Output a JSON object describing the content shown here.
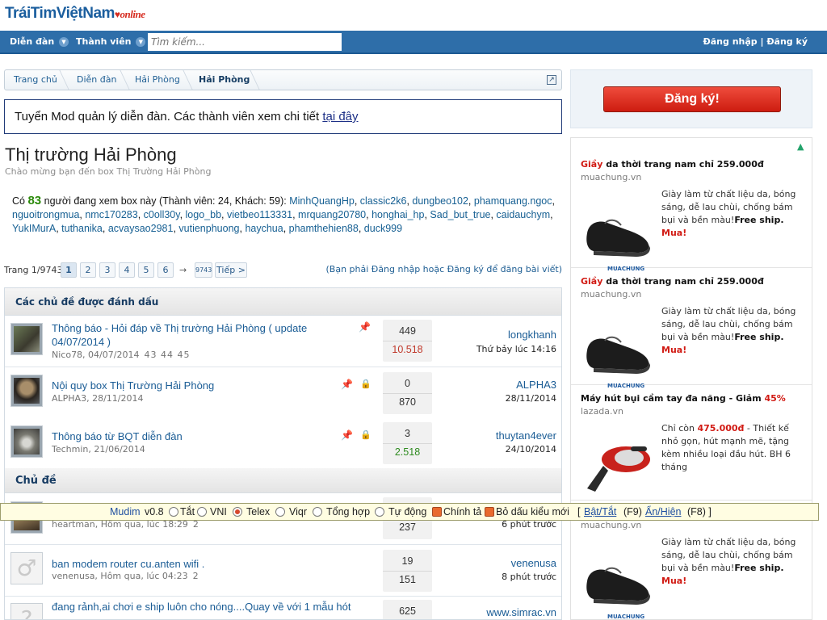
{
  "header": {
    "logo_main": "TráiTimViệtNam",
    "logo_online": "online",
    "nav": {
      "forums": "Diễn đàn",
      "members": "Thành viên"
    },
    "search_placeholder": "Tìm kiếm...",
    "login_links": "Đăng nhập | Đăng ký"
  },
  "breadcrumb": [
    "Trang chủ",
    "Diễn đàn",
    "Hải Phòng",
    "Hải Phòng"
  ],
  "notice": {
    "text": "Tuyển Mod quản lý diễn đàn. Các thành viên xem chi tiết ",
    "link": "tại đây"
  },
  "forum": {
    "title": "Thị trường Hải Phòng",
    "subtitle": "Chào mừng bạn đến box Thị Trường Hải Phòng"
  },
  "viewers": {
    "prefix": "Có",
    "count": "83",
    "summary": "người đang xem box này (Thành viên: 24, Khách: 59):",
    "members": [
      "MinhQuangHp",
      "classic2k6",
      "dungbeo102",
      "phamquang.ngoc",
      "nguoitrongmua",
      "nmc170283",
      "c0oll30y",
      "logo_bb",
      "vietbeo113331",
      "mrquang20780",
      "honghai_hp",
      "Sad_but_true",
      "caidauchym",
      "YukIMurA",
      "tuthanika",
      "acvaysao2981",
      "vutienphuong",
      "haychua",
      "phamthehien88",
      "duck999"
    ]
  },
  "pagination": {
    "label": "Trang 1/9743",
    "pages": [
      "1",
      "2",
      "3",
      "4",
      "5",
      "6"
    ],
    "arrow": "→",
    "last": "9743",
    "next": "Tiếp >",
    "post_hint": "(Bạn phải Đăng nhập hoặc Đăng ký để đăng bài viết)"
  },
  "sections": {
    "sticky": "Các chủ đề được đánh dấu",
    "normal": "Chủ đề"
  },
  "sticky_threads": [
    {
      "title": "Thông báo - Hỏi đáp về Thị trường Hải Phòng ( update 04/07/2014 )",
      "author_date": "Nico78, 04/07/2014",
      "pages": "43 44 45",
      "replies": "449",
      "views": "10.518",
      "views_color": "#c0392b",
      "last_user": "longkhanh",
      "last_time": "Thứ bảy lúc 14:16",
      "locked": false
    },
    {
      "title": "Nội quy box Thị Trường Hải Phòng",
      "author_date": "ALPHA3, 28/11/2014",
      "pages": "",
      "replies": "0",
      "views": "870",
      "views_color": "#333333",
      "last_user": "ALPHA3",
      "last_time": "28/11/2014",
      "locked": true
    },
    {
      "title": "Thông báo từ BQT diễn đàn",
      "author_date": "Techmin, 21/06/2014",
      "pages": "",
      "replies": "3",
      "views": "2.518",
      "views_color": "#2e8b1f",
      "last_user": "thuytan4ever",
      "last_time": "24/10/2014",
      "locked": true
    }
  ],
  "threads": [
    {
      "title": "",
      "author_date": "heartman, Hôm qua, lúc 18:29",
      "pages": "2",
      "replies": "",
      "views": "237",
      "last_user": "",
      "last_time": "6 phút trước"
    },
    {
      "title": "ban modem router cu.anten wifi .",
      "author_date": "venenusa, Hôm qua, lúc 04:23",
      "pages": "2",
      "replies": "19",
      "views": "151",
      "last_user": "venenusa",
      "last_time": "8 phút trước"
    },
    {
      "title": "đang rảnh,ai chơi e ship luôn cho nóng....Quay về với 1 mẫu hót",
      "author_date": "",
      "pages": "",
      "replies": "625",
      "views": "",
      "last_user": "www.simrac.vn",
      "last_time": ""
    }
  ],
  "mudim": {
    "name": "Mudim",
    "version": "v0.8",
    "off": "Tắt",
    "vni": "VNI",
    "telex": "Telex",
    "viqr": "Viqr",
    "combo": "Tổng hợp",
    "auto": "Tự động",
    "spell": "Chính tả",
    "accent": "Bỏ dấu kiểu mới",
    "open_bracket": "[",
    "toggle_link": "Bật/Tắt",
    "toggle_key": "(F9)",
    "hide_link": "Ẩn/Hiện",
    "hide_key": "(F8) ]"
  },
  "sidebar": {
    "signup": "Đăng ký!",
    "ads": [
      {
        "title_hl": "Giầy",
        "title": " da thời trang nam chỉ 259.000đ",
        "domain": "muachung.vn",
        "desc": "Giày làm từ chất liệu da, bóng sáng, dễ lau chùi, chống bám bụi và bền màu!",
        "desc_bold": "Free ship.",
        "desc_hl": "Mua!",
        "brand": "MUACHUNG"
      },
      {
        "title_hl": "Giầy",
        "title": " da thời trang nam chỉ 259.000đ",
        "domain": "muachung.vn",
        "desc": "Giày làm từ chất liệu da, bóng sáng, dễ lau chùi, chống bám bụi và bền màu!",
        "desc_bold": "Free ship.",
        "desc_hl": "Mua!",
        "brand": "MUACHUNG"
      },
      {
        "title_hl": "",
        "title": "Máy hút bụi cầm tay đa năng - Giảm ",
        "title_tail": "45%",
        "domain": "lazada.vn",
        "desc_pre": "Chỉ còn ",
        "price": "475.000đ",
        "desc": " - Thiết kế nhỏ gọn, hút mạnh mẽ, tặng kèm nhiều loại đầu hút. BH 6 tháng"
      },
      {
        "domain": "muachung.vn",
        "desc": "Giày làm từ chất liệu da, bóng sáng, dễ lau chùi, chống bám bụi và bền màu!",
        "desc_bold": "Free ship.",
        "desc_hl": "Mua!",
        "brand": "MUACHUNG"
      }
    ]
  },
  "colors": {
    "nav_bg": "#2e6ea9",
    "link": "#176093",
    "accent_red": "#d11b14",
    "notice_border": "#1f3a78"
  }
}
